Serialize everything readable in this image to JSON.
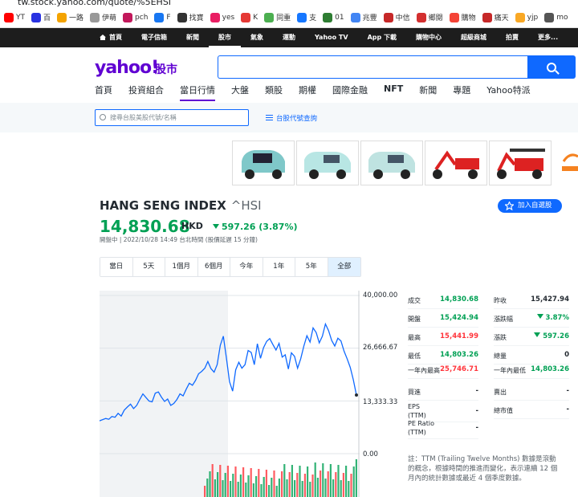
{
  "browser": {
    "url": "tw.stock.yahoo.com/quote/%5EHSI",
    "bookmarks": [
      {
        "label": "YT",
        "color": "#ff0000"
      },
      {
        "label": "百",
        "color": "#2932e1"
      },
      {
        "label": "一路",
        "color": "#f4a300"
      },
      {
        "label": "伊萌",
        "color": "#999999"
      },
      {
        "label": "pch",
        "color": "#c2185b"
      },
      {
        "label": "F",
        "color": "#1877f2"
      },
      {
        "label": "找寶",
        "color": "#333333"
      },
      {
        "label": "yes",
        "color": "#e91e63"
      },
      {
        "label": "K",
        "color": "#e53935"
      },
      {
        "label": "同重",
        "color": "#4caf50"
      },
      {
        "label": "支",
        "color": "#1677ff"
      },
      {
        "label": "01",
        "color": "#2e7d32"
      },
      {
        "label": "兆豐",
        "color": "#4285f4"
      },
      {
        "label": "中信",
        "color": "#c62828"
      },
      {
        "label": "鄉閱",
        "color": "#d32f2f"
      },
      {
        "label": "購物",
        "color": "#f44336"
      },
      {
        "label": "痛天",
        "color": "#c62828"
      },
      {
        "label": "yjp",
        "color": "#f9a825"
      },
      {
        "label": "mo",
        "color": "#555555"
      }
    ]
  },
  "topnav": [
    "首頁",
    "電子信箱",
    "新聞",
    "股市",
    "氣象",
    "運動",
    "Yahoo TV",
    "App 下載",
    "購物中心",
    "超級商城",
    "拍賣",
    "更多..."
  ],
  "header": {
    "logo": "yahoo!",
    "logo_sub": "股市",
    "search_value": ""
  },
  "subnav": [
    "首頁",
    "投資組合",
    "當日行情",
    "大盤",
    "類股",
    "期權",
    "國際金融",
    "NFT",
    "新聞",
    "專題",
    "Yahoo特派"
  ],
  "stock_search": {
    "placeholder": "搜尋台股美股代號/名稱",
    "code_link": "台股代號查詢"
  },
  "quote": {
    "name": "HANG SENG INDEX",
    "symbol": "^HSI",
    "price": "14,830.68",
    "currency": "HKD",
    "change": "597.26 (3.87%)",
    "meta": "開盤中 | 2022/10/28 14:49 台北時間 (股價延遲 15 分鐘)",
    "watch_button": "加入自選股"
  },
  "ranges": [
    "當日",
    "5天",
    "1個月",
    "6個月",
    "今年",
    "1年",
    "5年",
    "全部"
  ],
  "active_range": "全部",
  "chart_data": {
    "type": "line",
    "y_ticks": [
      "40,000.00",
      "26,666.67",
      "13,333.33",
      "0.00"
    ],
    "ylim": [
      0,
      40000
    ],
    "values": [
      8300,
      8600,
      8900,
      8700,
      9400,
      9200,
      10200,
      9500,
      11000,
      11800,
      12500,
      11400,
      12200,
      13700,
      15100,
      14200,
      13300,
      13100,
      15300,
      15600,
      14300,
      13200,
      13800,
      12200,
      12700,
      13700,
      15100,
      14600,
      16300,
      17800,
      17300,
      18500,
      20200,
      20800,
      21600,
      23300,
      21500,
      20600,
      22500,
      27400,
      29700,
      24100,
      18200,
      15800,
      21200,
      23100,
      21600,
      22500,
      26100,
      25600,
      22500,
      27800,
      24100,
      26800,
      28400,
      29100,
      27600,
      26200,
      27900,
      24400,
      25000,
      21400,
      25500,
      24600,
      21600,
      24000,
      27200,
      29800,
      28200,
      31800,
      30600,
      28000,
      29700,
      32800,
      31100,
      28600,
      27200,
      29200,
      28500,
      25900,
      24000,
      21800,
      18700,
      14830
    ],
    "volume_bars": 60
  },
  "stats": {
    "left": [
      {
        "label": "成交",
        "value": "14,830.68",
        "tone": "dn"
      },
      {
        "label": "開盤",
        "value": "15,424.94",
        "tone": "dn"
      },
      {
        "label": "最高",
        "value": "15,441.99",
        "tone": "up"
      },
      {
        "label": "最低",
        "value": "14,803.26",
        "tone": "dn"
      },
      {
        "label": "一年內最高",
        "value": "25,746.71",
        "tone": "up"
      },
      {
        "label": "買進",
        "value": "-",
        "tone": "nt"
      },
      {
        "label": "EPS (TTM)",
        "value": "-",
        "tone": "nt"
      },
      {
        "label": "PE Ratio (TTM)",
        "value": "-",
        "tone": "nt"
      }
    ],
    "right": [
      {
        "label": "昨收",
        "value": "15,427.94",
        "tone": "nt"
      },
      {
        "label": "漲跌幅",
        "value": "3.87%",
        "tone": "dn"
      },
      {
        "label": "漲跌",
        "value": "597.26",
        "tone": "dn"
      },
      {
        "label": "總量",
        "value": "0",
        "tone": "nt"
      },
      {
        "label": "一年內最低",
        "value": "14,803.26",
        "tone": "dn"
      },
      {
        "label": "賣出",
        "value": "-",
        "tone": "nt"
      },
      {
        "label": "總市值",
        "value": "-",
        "tone": "nt"
      }
    ],
    "note": "註：TTM (Trailing Twelve Months) 數據是滾動的概念，根據時間的推進而變化，表示連續 12 個月內的統計數據或最近 4 個季度數據。"
  },
  "colors": {
    "purple": "#6001d2",
    "blue": "#0f69ff",
    "green": "#00a054",
    "red": "#ff333a"
  }
}
